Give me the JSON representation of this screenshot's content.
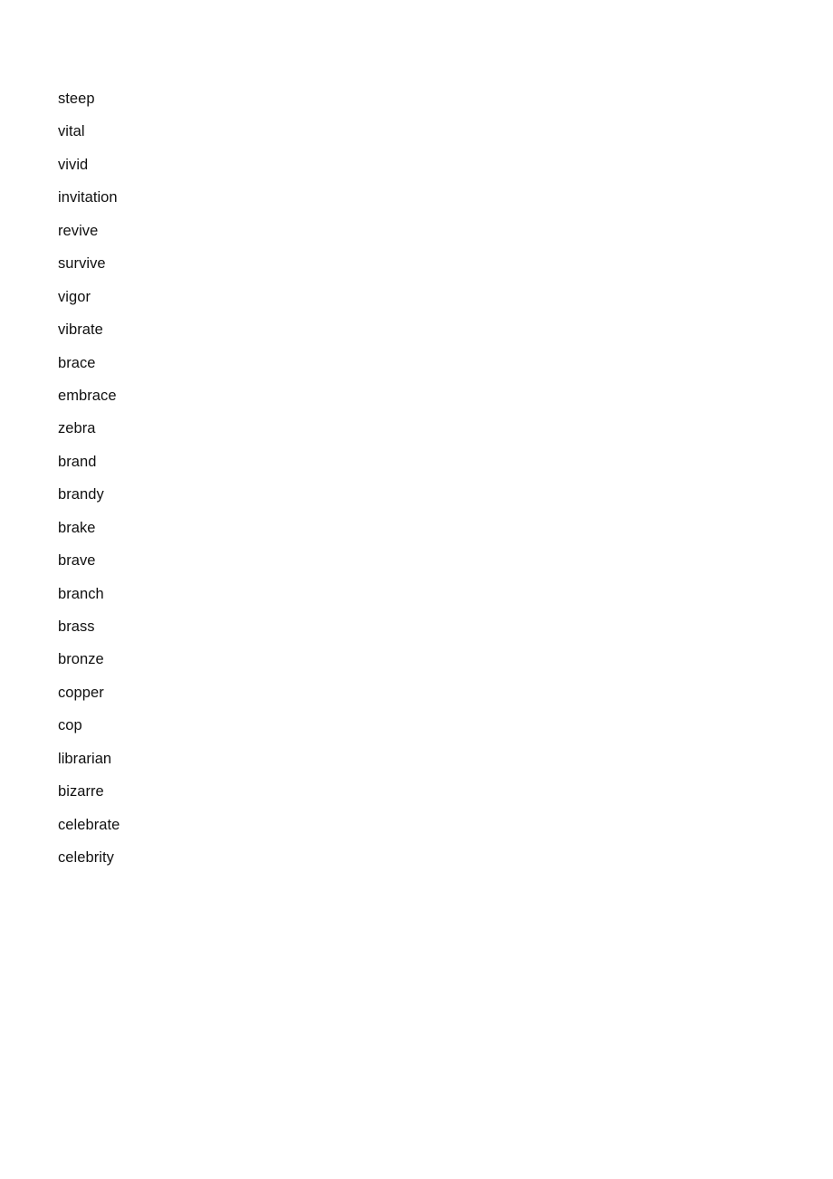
{
  "document": {
    "page_background": "#ffffff",
    "text_color": "#111111",
    "word_list": [
      "steep",
      "vital",
      "vivid",
      "invitation",
      "revive",
      "survive",
      "vigor",
      "vibrate",
      "brace",
      "embrace",
      "zebra",
      "brand",
      "brandy",
      "brake",
      "brave",
      "branch",
      "brass",
      "bronze",
      "copper",
      "cop",
      "librarian",
      "bizarre",
      "celebrate",
      "celebrity"
    ]
  }
}
